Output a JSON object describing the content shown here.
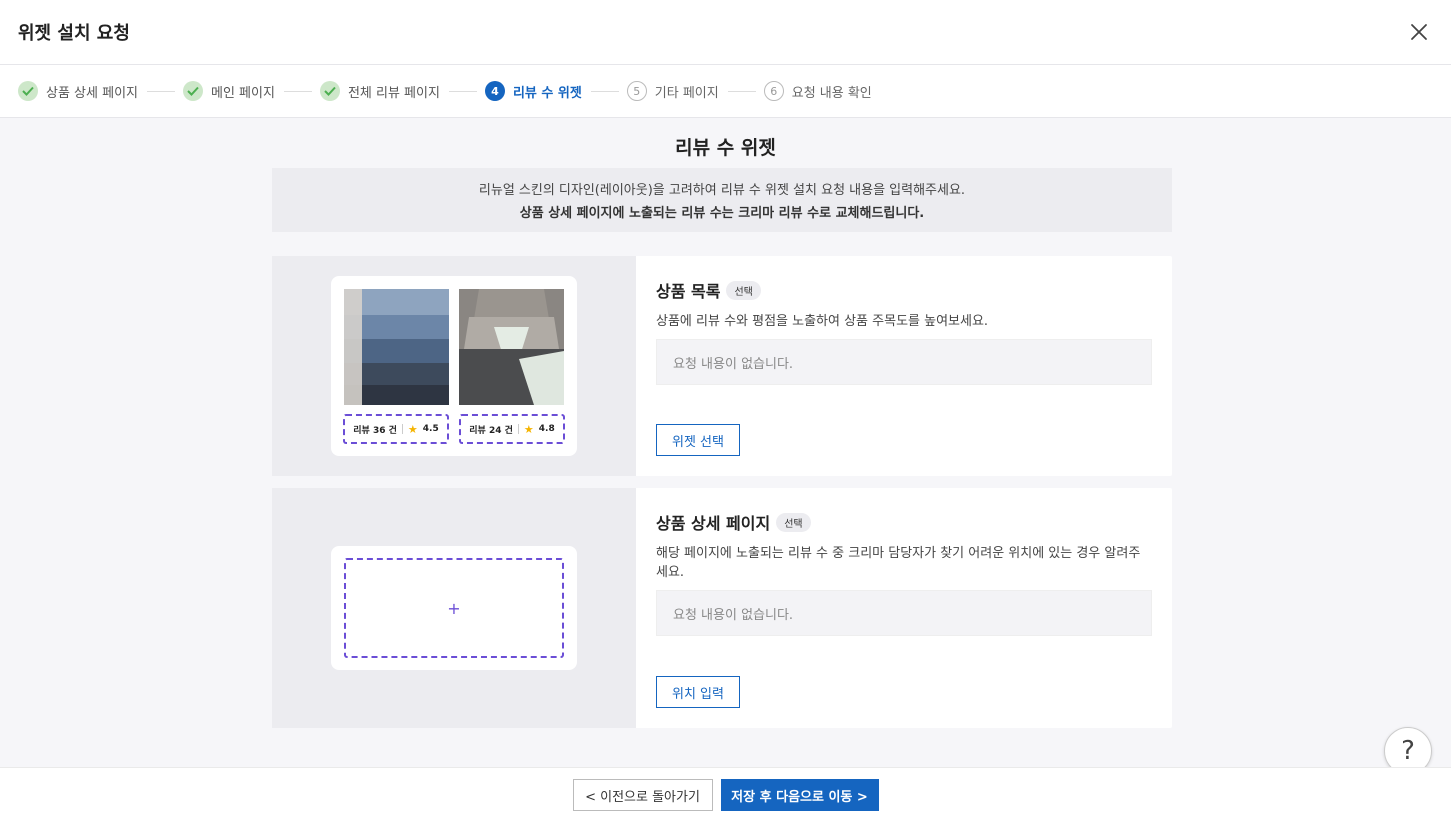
{
  "header": {
    "title": "위젯 설치 요청",
    "close_icon": "close-icon"
  },
  "stepper": {
    "steps": [
      {
        "label": "상품 상세 페이지",
        "state": "done",
        "marker": ""
      },
      {
        "label": "메인 페이지",
        "state": "done",
        "marker": ""
      },
      {
        "label": "전체 리뷰 페이지",
        "state": "done",
        "marker": ""
      },
      {
        "label": "리뷰 수 위젯",
        "state": "active",
        "marker": "4"
      },
      {
        "label": "기타 페이지",
        "state": "pending",
        "marker": "5"
      },
      {
        "label": "요청 내용 확인",
        "state": "pending",
        "marker": "6"
      }
    ]
  },
  "main": {
    "title": "리뷰 수 위젯",
    "notice_line1": "리뉴얼 스킨의 디자인(레이아웃)을 고려하여 리뷰 수 위젯 설치 요청 내용을 입력해주세요.",
    "notice_line2": "상품 상세 페이지에 노출되는 리뷰 수는 크리마 리뷰 수로 교체해드립니다."
  },
  "cards": [
    {
      "title": "상품 목록",
      "badge": "선택",
      "description": "상품에 리뷰 수와 평점을 노출하여 상품 주목도를 높여보세요.",
      "empty_text": "요청 내용이 없습니다.",
      "button_label": "위젯 선택",
      "preview_tags": [
        {
          "reviews": "리뷰 36 건",
          "rating": "4.5"
        },
        {
          "reviews": "리뷰 24 건",
          "rating": "4.8"
        }
      ]
    },
    {
      "title": "상품 상세 페이지",
      "badge": "선택",
      "description": "해당 페이지에 노출되는 리뷰 수 중 크리마 담당자가 찾기 어려운 위치에 있는 경우 알려주세요.",
      "empty_text": "요청 내용이 없습니다.",
      "button_label": "위치 입력",
      "add_symbol": "+"
    }
  ],
  "footer": {
    "prev_label": "< 이전으로 돌아가기",
    "next_label": "저장 후 다음으로 이동 >"
  },
  "help": {
    "symbol": "?"
  },
  "colors": {
    "accent": "#1565c0",
    "dashed": "#6b4ed6",
    "done": "#cde7c9",
    "star": "#f5b400"
  }
}
